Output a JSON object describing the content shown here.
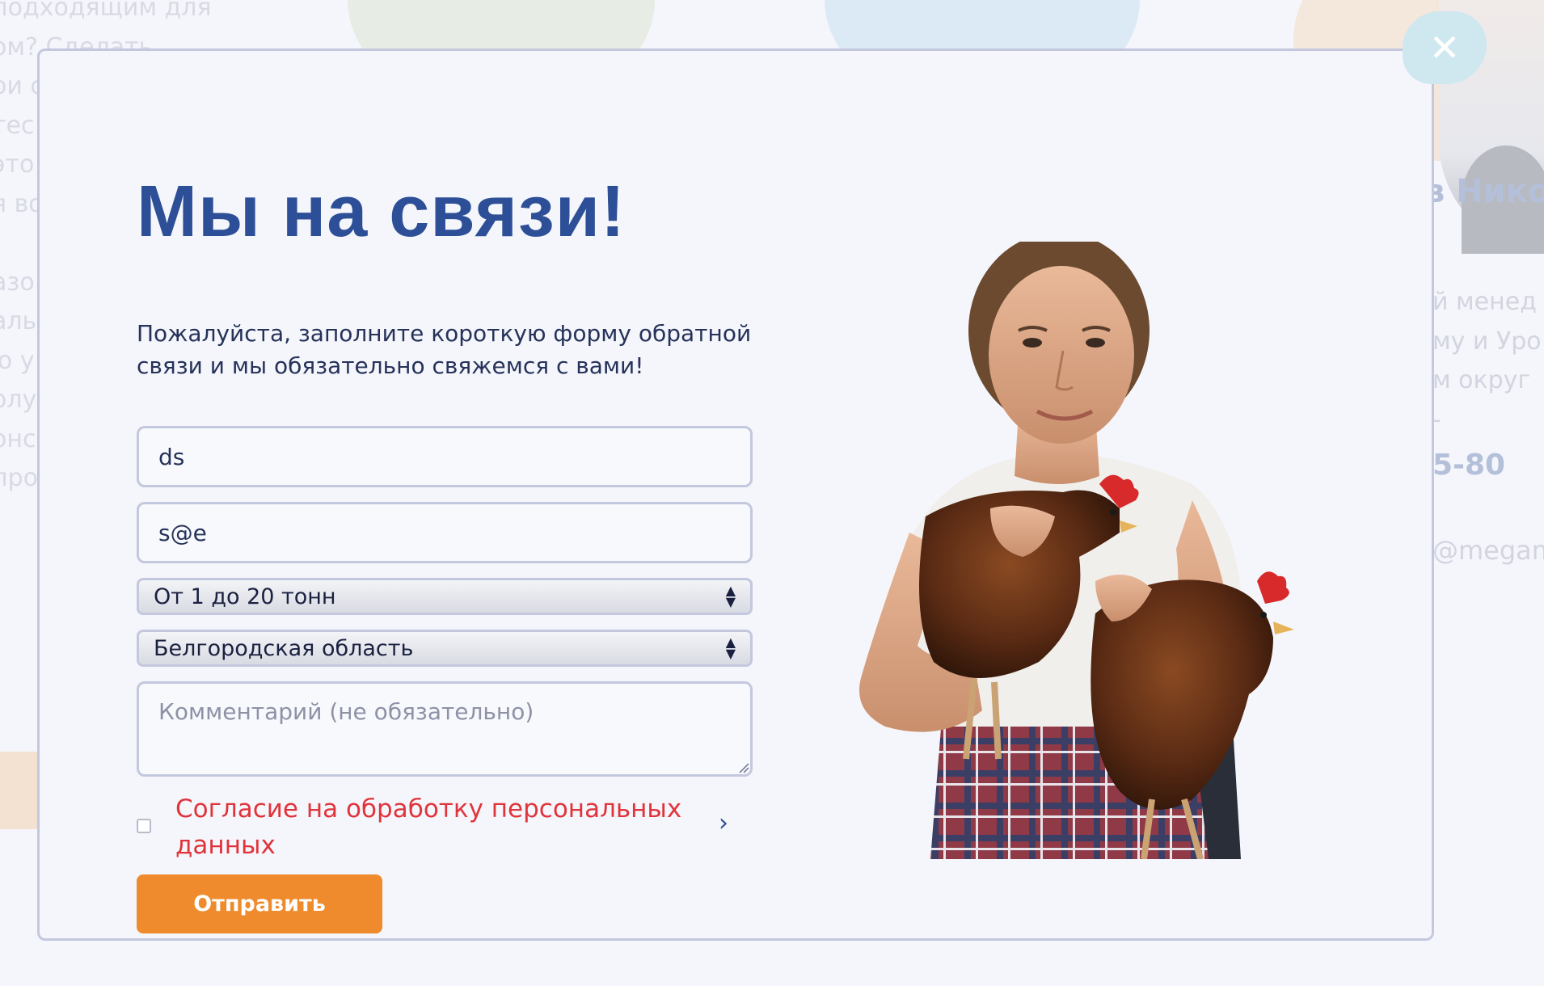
{
  "background": {
    "left_text_lines": [
      "подходящим для",
      "ом? Сделать",
      "ои с",
      "тес",
      "это",
      "я во",
      "",
      "азо",
      "аль",
      "ю у",
      "олу",
      "онс",
      "про"
    ],
    "right_name": "в Нико",
    "right_text_lines": [
      "й менед",
      "му и Уро",
      "м округ",
      "-"
    ],
    "right_phone": "5-80",
    "right_email": "@megam"
  },
  "modal": {
    "close_icon": "close-icon",
    "title": "Мы на связи!",
    "subtitle": "Пожалуйста, заполните короткую форму обратной связи и мы обязательно свяжемся с вами!",
    "form": {
      "name_value": "ds",
      "email_value": "s@e",
      "volume_selected": "От 1 до 20 тонн",
      "region_selected": "Белгородская область",
      "comment_placeholder": "Комментарий (не обязательно)",
      "consent_label": "Согласие на обработку персональных данных",
      "submit_label": "Отправить"
    }
  },
  "colors": {
    "title": "#2d4f97",
    "accent_orange": "#ef8b2c",
    "consent_red": "#e0343c",
    "border": "#c3c8de",
    "background": "#f5f6fb"
  }
}
